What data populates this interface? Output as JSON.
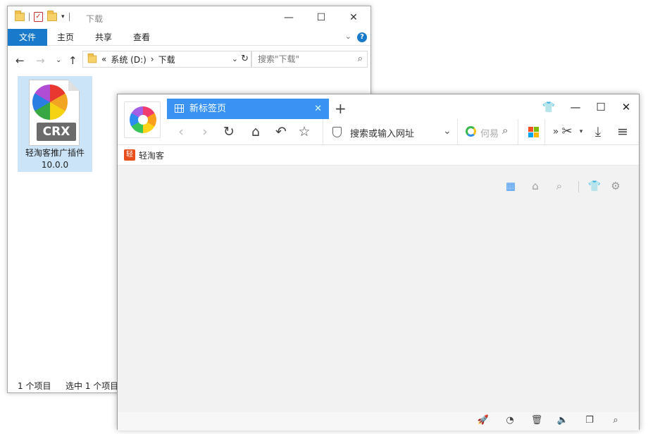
{
  "explorer": {
    "title": "下载",
    "controls": {
      "minimize": "—",
      "maximize": "☐",
      "close": "✕"
    },
    "ribbon": {
      "tabs": [
        "文件",
        "主页",
        "共享",
        "查看"
      ],
      "help": "?"
    },
    "address": {
      "chevron": "«",
      "drive": "系统 (D:)",
      "arrow": "›",
      "folder": "下载"
    },
    "search": {
      "placeholder": "搜索\"下载\""
    },
    "file": {
      "icon_label": "CRX",
      "name_line1": "轻淘客推广插件",
      "name_line2": "10.0.0"
    },
    "status": {
      "count": "1 个项目",
      "selected": "选中 1 个项目"
    }
  },
  "browser": {
    "tab": {
      "label": "新标签页"
    },
    "toolbar": {
      "url_placeholder": "搜索或输入网址",
      "search_placeholder": "何易"
    },
    "bookmarks": [
      {
        "icon_text": "轻",
        "label": "轻淘客"
      }
    ],
    "colors": {
      "tab_active": "#3a93f3",
      "windows_icon": [
        "#f25022",
        "#7fba00",
        "#00a4ef",
        "#ffb900"
      ]
    }
  }
}
